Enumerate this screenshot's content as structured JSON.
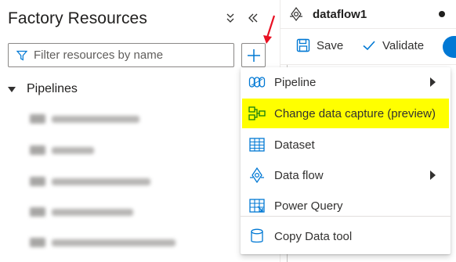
{
  "panel": {
    "title": "Factory Resources",
    "filter_placeholder": "Filter resources by name",
    "section_label": "Pipelines"
  },
  "tab": {
    "title": "dataflow1"
  },
  "toolbar": {
    "save_label": "Save",
    "validate_label": "Validate"
  },
  "menu": {
    "items": [
      {
        "label": "Pipeline",
        "icon": "pipeline-icon",
        "has_submenu": true
      },
      {
        "label": "Change data capture (preview)",
        "icon": "change-data-capture-icon",
        "highlighted": true
      },
      {
        "label": "Dataset",
        "icon": "dataset-table-icon"
      },
      {
        "label": "Data flow",
        "icon": "data-flow-icon",
        "has_submenu": true
      },
      {
        "label": "Power Query",
        "icon": "power-query-icon"
      },
      {
        "label": "Copy Data tool",
        "icon": "copy-data-tool-icon"
      }
    ]
  },
  "colors": {
    "accent": "#0078d4",
    "highlight": "#ffff00",
    "annotation_arrow": "#e81123"
  }
}
